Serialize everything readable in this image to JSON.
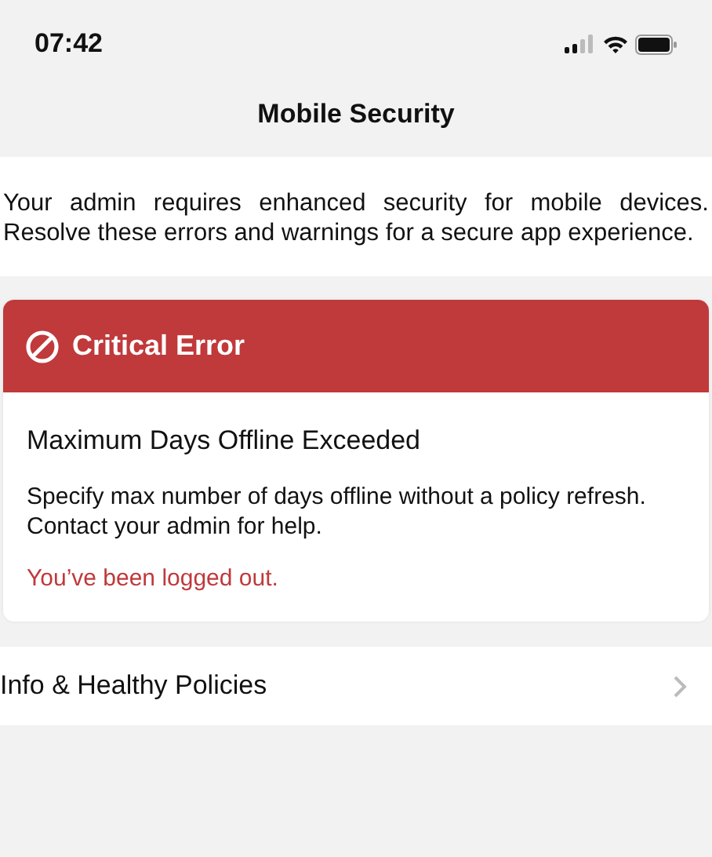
{
  "status_bar": {
    "time": "07:42"
  },
  "nav": {
    "title": "Mobile Security"
  },
  "intro": "Your admin requires enhanced security for mobile devices. Resolve these errors and warnings for a secure app experience.",
  "alerts": [
    {
      "kind": "error",
      "header": "Critical Error",
      "title": "Maximum Days Offline Exceeded",
      "description": "Specify max number of days offline without a policy refresh. Contact your admin for help.",
      "result": "You’ve been logged out."
    }
  ],
  "links": [
    {
      "label": "Info & Healthy Policies"
    }
  ]
}
